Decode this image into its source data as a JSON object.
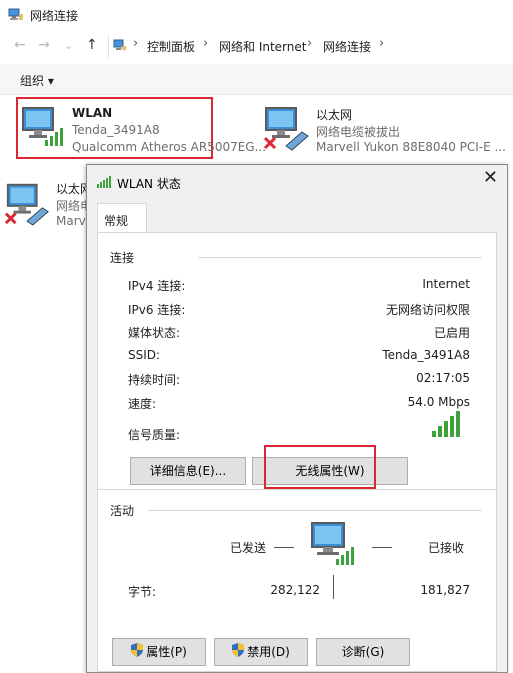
{
  "window": {
    "title": "网络连接"
  },
  "nav": {
    "back": "←",
    "forward": "→",
    "recent": "⌄",
    "up": "↑",
    "breadcrumb": [
      "控制面板",
      "网络和 Internet",
      "网络连接"
    ],
    "separator": "›",
    "end_chevron": "›"
  },
  "commandbar": {
    "organize": "组织 ▾"
  },
  "adapters": [
    {
      "name": "WLAN",
      "line1": "Tenda_3491A8",
      "line2": "Qualcomm Atheros AR5007EG..."
    },
    {
      "name": "以太网",
      "line1": "网络电缆被拔出",
      "line2": "Marvell Yukon 88E8040 PCI-E ..."
    },
    {
      "name": "以太网",
      "line1": "网络电",
      "line2": "Marv"
    }
  ],
  "dialog": {
    "title": "WLAN 状态",
    "close": "✕",
    "tab": "常规",
    "connection_group": "连接",
    "rows": [
      {
        "label": "IPv4 连接:",
        "value": "Internet"
      },
      {
        "label": "IPv6 连接:",
        "value": "无网络访问权限"
      },
      {
        "label": "媒体状态:",
        "value": "已启用"
      },
      {
        "label": "SSID:",
        "value": "Tenda_3491A8"
      },
      {
        "label": "持续时间:",
        "value": "02:17:05"
      },
      {
        "label": "速度:",
        "value": "54.0 Mbps"
      },
      {
        "label": "信号质量:",
        "value": ""
      }
    ],
    "details_button": "详细信息(E)...",
    "wireless_button": "无线属性(W)",
    "activity_group": "活动",
    "sent_label": "已发送",
    "received_label": "已接收",
    "bytes_label": "字节:",
    "bytes_sent": "282,122",
    "bytes_received": "181,827",
    "properties_button": "属性(P)",
    "disable_button": "禁用(D)",
    "diagnose_button": "诊断(G)",
    "signal_bars": 5
  },
  "colors": {
    "highlight": "#d9282f",
    "signal": "#3da23a",
    "monitor": "#3b8fd6"
  }
}
